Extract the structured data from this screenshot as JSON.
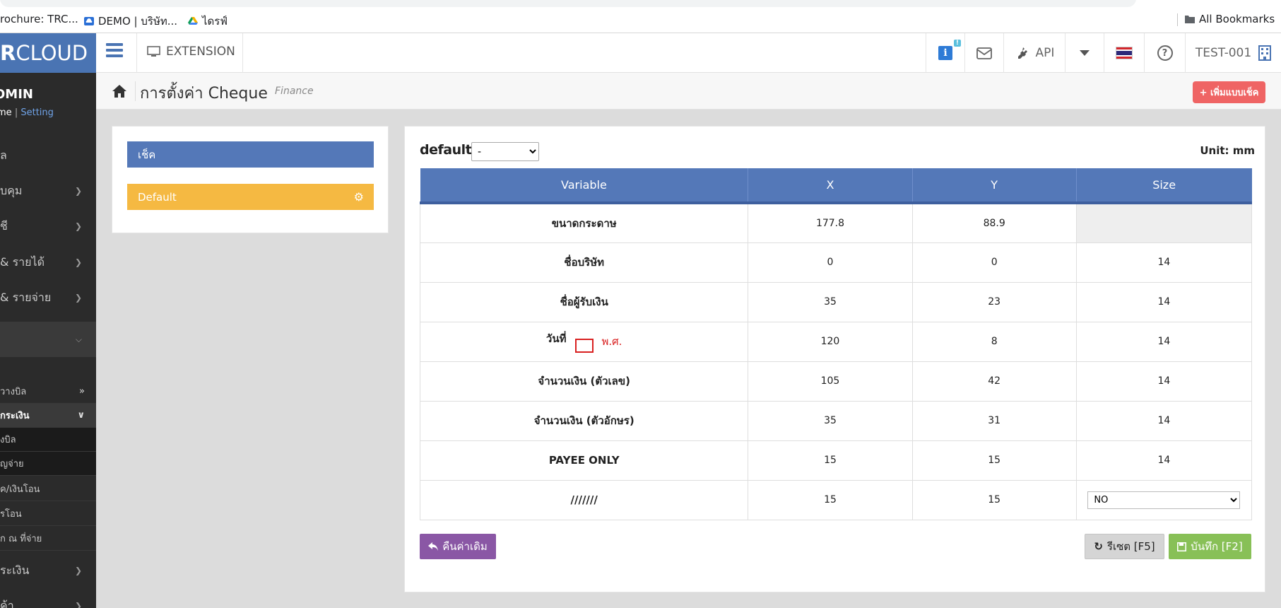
{
  "bookmarks": {
    "items": [
      {
        "label": "rochure: TRC..."
      },
      {
        "label": "DEMO | บริษัท..."
      },
      {
        "label": "ไดรฟ์"
      }
    ],
    "all_bookmarks": "All Bookmarks"
  },
  "header": {
    "logo_bold": "R",
    "logo_rest": "CLOUD",
    "extension": "EXTENSION",
    "info_badge": "!",
    "api": "API",
    "user": "TEST-001"
  },
  "sidebar": {
    "admin": "OMIN",
    "home": "me",
    "sep": "|",
    "setting": "Setting",
    "items": [
      {
        "label": "ล"
      },
      {
        "label": "บคุม"
      },
      {
        "label": "ชี"
      },
      {
        "label": " & รายได้"
      },
      {
        "label": "& รายจ่าย"
      },
      {
        "label": ""
      }
    ],
    "subitems": [
      {
        "label": "วางบิล"
      },
      {
        "label": "กระเงิน"
      },
      {
        "label": "งบิล"
      },
      {
        "label": "ญจ่าย"
      },
      {
        "label": "ค/เงินโอน"
      },
      {
        "label": "รโอน"
      },
      {
        "label": "ก ณ ที่จ่าย"
      }
    ],
    "bottom_items": [
      {
        "label": "ระเงิน"
      },
      {
        "label": "ค้า"
      }
    ]
  },
  "titlebar": {
    "title": "การตั้งค่า Cheque",
    "subtitle": "Finance",
    "add_button": "+ เพิ่มแบบเช็ค"
  },
  "left_panel": {
    "cheque": "เช็ค",
    "default": "Default"
  },
  "main": {
    "default_label": "default",
    "colon": ":",
    "select_value": "-",
    "unit": "Unit: mm",
    "columns": [
      "Variable",
      "X",
      "Y",
      "Size"
    ],
    "rows": [
      {
        "variable": "ขนาดกระดาษ",
        "x": "177.8",
        "y": "88.9",
        "size": ""
      },
      {
        "variable": "ชื่อบริษัท",
        "x": "0",
        "y": "0",
        "size": "14"
      },
      {
        "variable": "ชื่อผู้รับเงิน",
        "x": "35",
        "y": "23",
        "size": "14"
      },
      {
        "variable": "วันที่",
        "x": "120",
        "y": "8",
        "size": "14",
        "checkbox_label": "พ.ศ."
      },
      {
        "variable": "จำนวนเงิน (ตัวเลข)",
        "x": "105",
        "y": "42",
        "size": "14"
      },
      {
        "variable": "จำนวนเงิน (ตัวอักษร)",
        "x": "35",
        "y": "31",
        "size": "14"
      },
      {
        "variable": "PAYEE ONLY",
        "x": "15",
        "y": "15",
        "size": "14"
      },
      {
        "variable": "///////",
        "x": "15",
        "y": "15",
        "size_select": "NO"
      }
    ],
    "revert_button": "คืนค่าเดิม",
    "reset_button": "รีเซต [F5]",
    "save_button": "บันทึก [F2]"
  },
  "colors": {
    "brand_blue": "#4a74b3",
    "header_blue": "#5478b8",
    "default_yellow": "#f5b942",
    "add_red": "#ef6464",
    "revert_purple": "#8a57a5",
    "save_green": "#88c057",
    "sidebar_dark": "#2b2b2b"
  }
}
